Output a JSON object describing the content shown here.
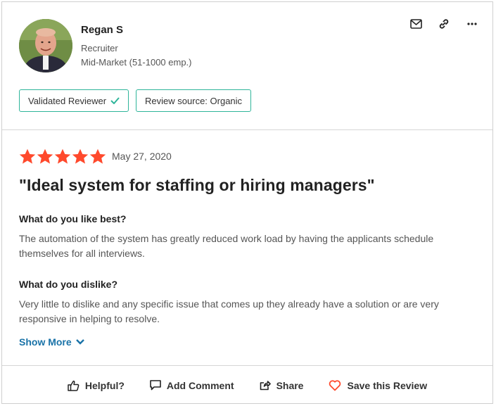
{
  "reviewer": {
    "name": "Regan S",
    "title": "Recruiter",
    "segment": "Mid-Market (51-1000 emp.)"
  },
  "header_actions": {
    "icons": [
      "mail-icon",
      "link-icon",
      "more-icon"
    ]
  },
  "badges": {
    "validated": "Validated Reviewer",
    "source": "Review source: Organic"
  },
  "review": {
    "rating": 5,
    "rating_max": 5,
    "date": "May 27, 2020",
    "title": "\"Ideal system for staffing or hiring managers\"",
    "q1": "What do you like best?",
    "a1": "The automation of the system has greatly reduced work load by having the applicants schedule themselves for all interviews.",
    "q2": "What do you dislike?",
    "a2": "Very little to dislike and any specific issue that comes up they already have a solution or are very responsive in helping to resolve.",
    "show_more": "Show More"
  },
  "footer": {
    "helpful": "Helpful?",
    "comment": "Add Comment",
    "share": "Share",
    "save": "Save this Review"
  },
  "colors": {
    "star": "#ff492c",
    "badge_border": "#2fb59a",
    "link": "#1a73a8",
    "heart": "#ff492c"
  }
}
